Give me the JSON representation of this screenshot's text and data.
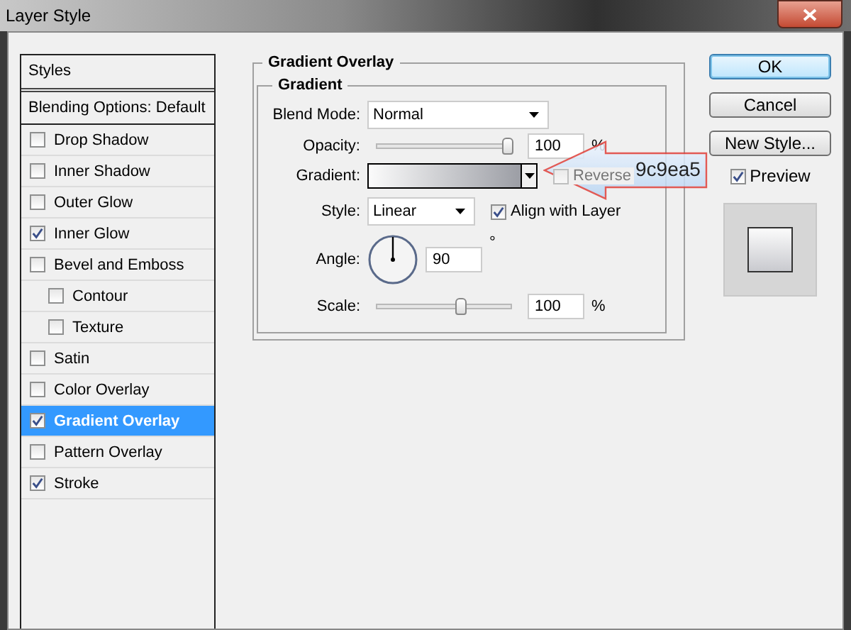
{
  "window": {
    "title": "Layer Style"
  },
  "styles_list": {
    "header": "Styles",
    "blending": "Blending Options: Default",
    "items": [
      {
        "label": "Drop Shadow",
        "checked": false,
        "selected": false
      },
      {
        "label": "Inner Shadow",
        "checked": false,
        "selected": false
      },
      {
        "label": "Outer Glow",
        "checked": false,
        "selected": false
      },
      {
        "label": "Inner Glow",
        "checked": true,
        "selected": false
      },
      {
        "label": "Bevel and Emboss",
        "checked": false,
        "selected": false,
        "children": [
          {
            "label": "Contour",
            "checked": false,
            "selected": false
          },
          {
            "label": "Texture",
            "checked": false,
            "selected": false
          }
        ]
      },
      {
        "label": "Satin",
        "checked": false,
        "selected": false
      },
      {
        "label": "Color Overlay",
        "checked": false,
        "selected": false
      },
      {
        "label": "Gradient Overlay",
        "checked": true,
        "selected": true
      },
      {
        "label": "Pattern Overlay",
        "checked": false,
        "selected": false
      },
      {
        "label": "Stroke",
        "checked": true,
        "selected": false
      }
    ]
  },
  "panel": {
    "title": "Gradient Overlay",
    "group": "Gradient",
    "blend_mode": {
      "label": "Blend Mode:",
      "value": "Normal"
    },
    "opacity": {
      "label": "Opacity:",
      "value": "100",
      "unit": "%",
      "level": 0.97
    },
    "gradient": {
      "label": "Gradient:"
    },
    "reverse": {
      "label": "Reverse",
      "checked": false,
      "disabled": true
    },
    "style": {
      "label": "Style:",
      "value": "Linear"
    },
    "align": {
      "label": "Align with Layer",
      "checked": true
    },
    "angle": {
      "label": "Angle:",
      "value": "90",
      "unit": "°"
    },
    "scale": {
      "label": "Scale:",
      "value": "100",
      "unit": "%",
      "level": 0.62
    }
  },
  "buttons": [
    {
      "label": "OK",
      "default": true
    },
    {
      "label": "Cancel",
      "default": false
    },
    {
      "label": "New Style...",
      "default": false
    }
  ],
  "preview": {
    "label": "Preview",
    "checked": true
  },
  "annotation": {
    "text": "9c9ea5"
  }
}
